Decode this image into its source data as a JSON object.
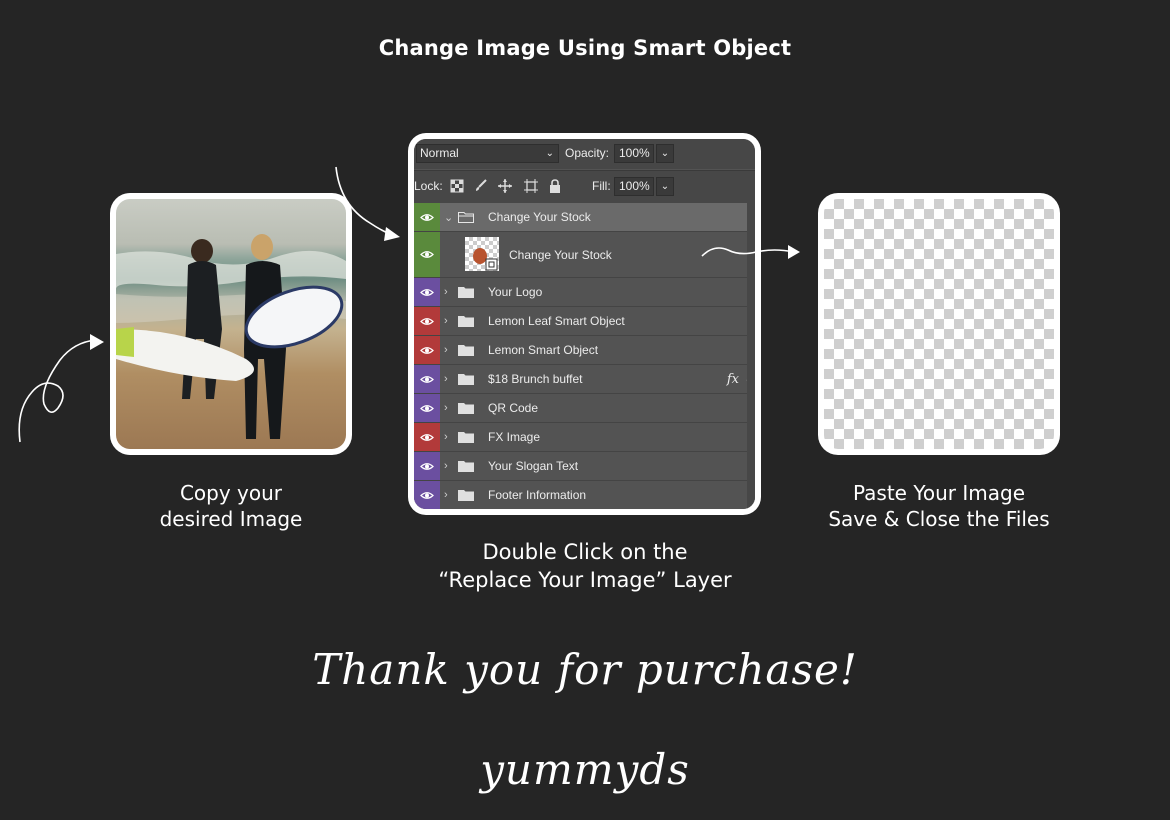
{
  "title": "Change Image Using Smart Object",
  "steps": {
    "left_caption_line1": "Copy your",
    "left_caption_line2": "desired Image",
    "center_caption_line1": "Double Click on the",
    "center_caption_line2": "“Replace Your Image” Layer",
    "right_caption_line1": "Paste Your Image",
    "right_caption_line2": "Save & Close the Files"
  },
  "layers_panel": {
    "blend_mode": "Normal",
    "opacity_label": "Opacity:",
    "opacity_value": "100%",
    "lock_label": "Lock:",
    "fill_label": "Fill:",
    "fill_value": "100%",
    "layers": [
      {
        "name": "Change Your Stock",
        "color": "#5a8a3c",
        "kind": "group",
        "expanded": true,
        "selected": true
      },
      {
        "name": "Change Your Stock",
        "color": "#5a8a3c",
        "kind": "smart-object"
      },
      {
        "name": "Your Logo",
        "color": "#6b4fa0",
        "kind": "group"
      },
      {
        "name": "Lemon Leaf Smart Object",
        "color": "#b23a3a",
        "kind": "group"
      },
      {
        "name": "Lemon Smart Object",
        "color": "#b23a3a",
        "kind": "group"
      },
      {
        "name": "$18 Brunch buffet",
        "color": "#6b4fa0",
        "kind": "group",
        "fx": "fx"
      },
      {
        "name": "QR Code",
        "color": "#6b4fa0",
        "kind": "group"
      },
      {
        "name": "FX Image",
        "color": "#b23a3a",
        "kind": "group"
      },
      {
        "name": "Your Slogan Text",
        "color": "#6b4fa0",
        "kind": "group"
      },
      {
        "name": "Footer Information",
        "color": "#6b4fa0",
        "kind": "group"
      }
    ]
  },
  "footer_signature": "Thank you for purchase! yummyds"
}
